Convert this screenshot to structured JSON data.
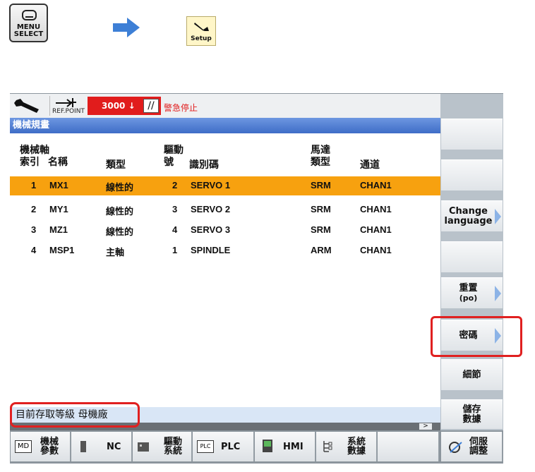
{
  "top_icons": {
    "menu_select_line1": "MENU",
    "menu_select_line2": "SELECT",
    "setup_label": "Setup"
  },
  "status": {
    "refpoint_label": "REF.POINT",
    "alarm_number": "3000",
    "alarm_text": "警急停止"
  },
  "window_title": "機械規畫",
  "table": {
    "headers": {
      "axis_top": "機械軸",
      "index": "索引",
      "name": "名稱",
      "type": "類型",
      "drive_top": "驅動",
      "drive_no": "號",
      "identifier": "識別碼",
      "motor_top": "馬達",
      "motor_type": "類型",
      "channel": "通道"
    },
    "rows": [
      {
        "index": "1",
        "name": "MX1",
        "type": "線性的",
        "drive": "2",
        "id": "SERVO 1",
        "motor": "SRM",
        "channel": "CHAN1"
      },
      {
        "index": "2",
        "name": "MY1",
        "type": "線性的",
        "drive": "3",
        "id": "SERVO 2",
        "motor": "SRM",
        "channel": "CHAN1"
      },
      {
        "index": "3",
        "name": "MZ1",
        "type": "線性的",
        "drive": "4",
        "id": "SERVO 3",
        "motor": "SRM",
        "channel": "CHAN1"
      },
      {
        "index": "4",
        "name": "MSP1",
        "type": "主軸",
        "drive": "1",
        "id": "SPINDLE",
        "motor": "ARM",
        "channel": "CHAN1"
      }
    ]
  },
  "access_level": "目前存取等級 母機廠",
  "scroll_button": ">",
  "softkeys_right": {
    "k3_line1": "Change",
    "k3_line2": "language",
    "k5_line1": "重置",
    "k5_line2": "(po)",
    "k6": "密碼",
    "k7": "細節",
    "k8_line1": "儲存",
    "k8_line2": "數據"
  },
  "softkeys_bottom": {
    "md_icon": "MD",
    "md_line1": "機械",
    "md_line2": "參數",
    "nc": "NC",
    "drive_line1": "驅動",
    "drive_line2": "系統",
    "plc_icon": "PLC",
    "plc": "PLC",
    "hmi": "HMI",
    "sys_line1": "系統",
    "sys_line2": "數據",
    "servo_line1": "伺服",
    "servo_line2": "調整"
  },
  "colors": {
    "selected_row": "#f7a10f",
    "title_bar": "#3f6dc7",
    "alarm": "#e11c1c",
    "highlight_box": "#e02020"
  }
}
